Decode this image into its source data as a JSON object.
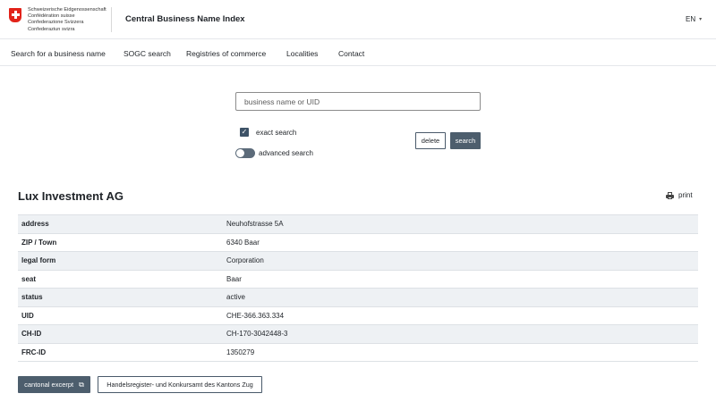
{
  "header": {
    "confederation_lines": [
      "Schweizerische Eidgenossenschaft",
      "Confédération suisse",
      "Confederazione Svizzera",
      "Confederaziun svizra"
    ],
    "site_title": "Central Business Name Index",
    "language": "EN"
  },
  "nav": {
    "items": [
      "Search for a business name",
      "SOGC search",
      "Registries of commerce",
      "Localities",
      "Contact"
    ]
  },
  "search": {
    "placeholder": "business name or UID",
    "value": "",
    "exact_search_label": "exact search",
    "exact_search_checked": true,
    "advanced_search_label": "advanced search",
    "advanced_search_on": false,
    "delete_label": "delete",
    "search_label": "search"
  },
  "company": {
    "name": "Lux Investment AG",
    "print_label": "print",
    "rows": [
      {
        "label": "address",
        "value": "Neuhofstrasse 5A"
      },
      {
        "label": "ZIP / Town",
        "value": "6340 Baar"
      },
      {
        "label": "legal form",
        "value": "Corporation"
      },
      {
        "label": "seat",
        "value": "Baar"
      },
      {
        "label": "status",
        "value": "active"
      },
      {
        "label": "UID",
        "value": "CHE-366.363.334"
      },
      {
        "label": "CH-ID",
        "value": "CH-170-3042448-3"
      },
      {
        "label": "FRC-ID",
        "value": "1350279"
      }
    ]
  },
  "actions": {
    "cantonal_excerpt_label": "cantonal excerpt",
    "registry_office_label": "Handelsregister- und Konkursamt des Kantons Zug"
  },
  "colors": {
    "swiss_red": "#e2231a",
    "primary_button": "#4d5e6d",
    "row_stripe": "#eef1f4"
  }
}
